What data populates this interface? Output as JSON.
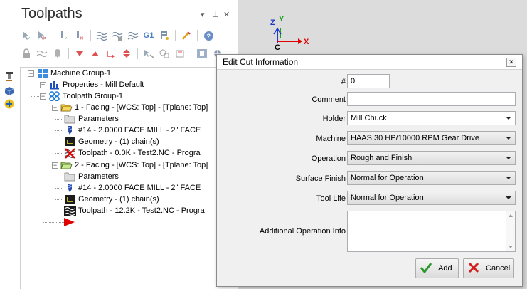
{
  "panel": {
    "title": "Toolpaths",
    "pin_glyph": "▾ ⊕",
    "close_glyph": "✕",
    "toolbar_g1": "G1"
  },
  "tree": {
    "machine_group": "Machine Group-1",
    "properties": "Properties - Mill Default",
    "toolpath_group": "Toolpath Group-1",
    "op1": {
      "title": "1 - Facing - [WCS: Top] - [Tplane: Top]",
      "parameters": "Parameters",
      "tool": "#14 - 2.0000 FACE MILL - 2\"  FACE",
      "geometry": "Geometry - (1) chain(s)",
      "toolpath": "Toolpath - 0.0K - Test2.NC - Progra"
    },
    "op2": {
      "title": "2 - Facing - [WCS: Top] - [Tplane: Top]",
      "parameters": "Parameters",
      "tool": "#14 - 2.0000 FACE MILL - 2\"  FACE",
      "geometry": "Geometry - (1) chain(s)",
      "toolpath": "Toolpath - 12.2K - Test2.NC - Progra"
    }
  },
  "axes": {
    "x": "X",
    "y": "Y",
    "z": "Z",
    "c": "C"
  },
  "dialog": {
    "title": "Edit Cut Information",
    "close_glyph": "✕",
    "labels": {
      "number": "#",
      "comment": "Comment",
      "holder": "Holder",
      "machine": "Machine",
      "operation": "Operation",
      "surface_finish": "Surface Finish",
      "tool_life": "Tool Life",
      "additional": "Additional Operation Info"
    },
    "values": {
      "number": "0",
      "comment": "",
      "holder": "Mill Chuck",
      "machine": "HAAS 30 HP/10000 RPM Gear Drive",
      "operation": "Rough and Finish",
      "surface_finish": "Normal for Operation",
      "tool_life": "Normal for Operation",
      "additional": ""
    },
    "buttons": {
      "add": "Add",
      "cancel": "Cancel"
    }
  },
  "colors": {
    "accent_red": "#e00000",
    "axis_blue": "#2038c8",
    "axis_green": "#20a020",
    "check_green": "#2a9a2a"
  }
}
